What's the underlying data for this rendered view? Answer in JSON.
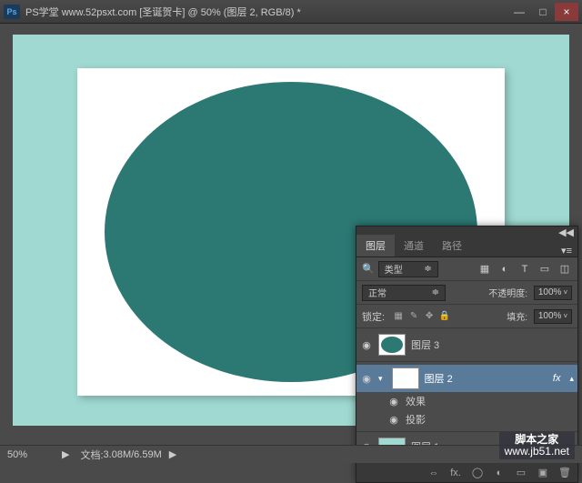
{
  "titlebar": {
    "ps_icon": "Ps",
    "title": "PS学堂 www.52psxt.com [圣诞贺卡] @ 50% (图层 2, RGB/8) *"
  },
  "window_controls": {
    "min": "—",
    "max": "□",
    "close": "×"
  },
  "statusbar": {
    "zoom": "50%",
    "arrow": "▶",
    "doc_label": "文档:",
    "doc_size": "3.08M/6.59M",
    "more": "▶"
  },
  "layers_panel": {
    "tabs": {
      "layers": "图层",
      "channels": "通道",
      "paths": "路径"
    },
    "filter_label": "类型",
    "filter_icons": {
      "img": "▦",
      "adj": "◐",
      "type": "T",
      "shape": "▭",
      "smart": "◫"
    },
    "blend_mode": "正常",
    "opacity_label": "不透明度:",
    "opacity_value": "100%",
    "lock_label": "锁定:",
    "lock_icons": {
      "pixels": "▦",
      "pos": "✎",
      "move": "✥",
      "all": "🔒"
    },
    "fill_label": "填充:",
    "fill_value": "100%",
    "layers": [
      {
        "name": "图层 3"
      },
      {
        "name": "图层 2",
        "fx": "fx",
        "effects_label": "效果",
        "shadow_label": "投影"
      },
      {
        "name": "图层 1"
      }
    ],
    "footer_icons": {
      "link": "⇔",
      "fx": "fx.",
      "mask": "◯",
      "adj": "◐",
      "group": "▭",
      "new": "▣",
      "trash": "🗑"
    }
  },
  "watermark": {
    "line1": "脚本之家",
    "line2": "www.jb51.net"
  }
}
